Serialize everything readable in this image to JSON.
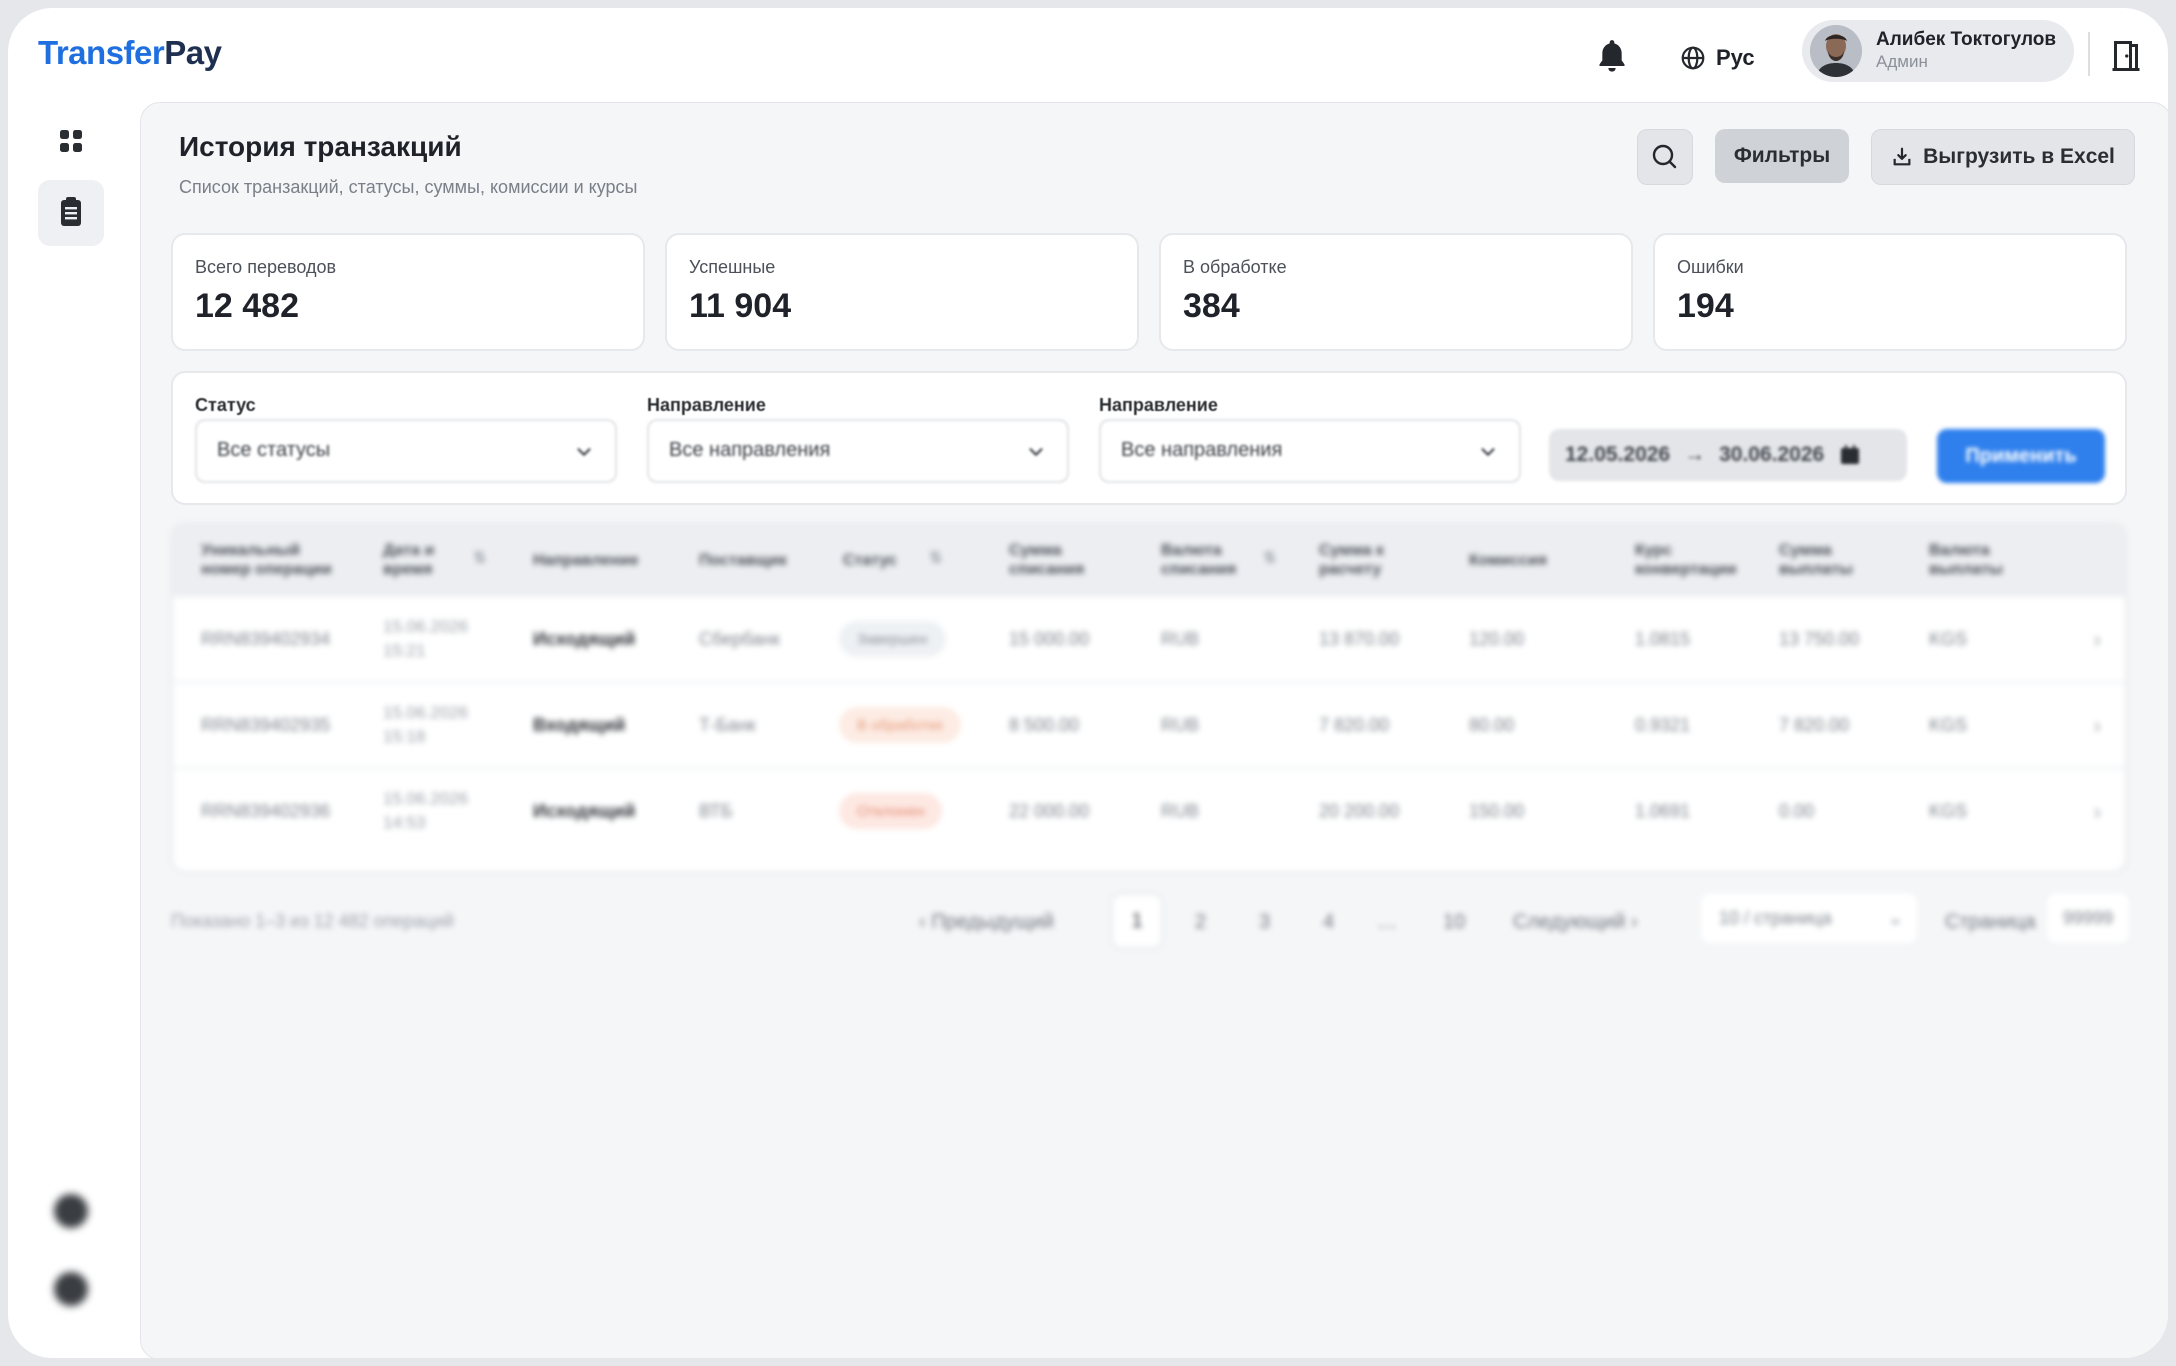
{
  "app": {
    "logo_part1": "Transfer",
    "logo_part2": "Pay"
  },
  "header": {
    "language": "Рус",
    "user_name": "Алибек Токтогулов",
    "user_role": "Админ",
    "icons": [
      "bell-icon",
      "globe-icon",
      "logout-door-icon"
    ]
  },
  "sidebar": {
    "items": [
      {
        "icon": "grid-icon"
      },
      {
        "icon": "clipboard-icon",
        "active": true
      }
    ]
  },
  "page": {
    "title": "История транзакций",
    "subtitle": "Список транзакций, статусы, суммы, комиссии и курсы",
    "filters_label": "Фильтры",
    "export_label": "Выгрузить в Excel"
  },
  "stats": [
    {
      "label": "Всего переводов",
      "value": "12 482"
    },
    {
      "label": "Успешные",
      "value": "11 904"
    },
    {
      "label": "В обработке",
      "value": "384"
    },
    {
      "label": "Ошибки",
      "value": "194"
    }
  ],
  "filters": {
    "status_label": "Статус",
    "status_value": "Все статусы",
    "direction_label": "Направление",
    "direction_value": "Все направления",
    "direction2_label": "Направление",
    "direction2_value": "Все направления",
    "date_from": "12.05.2026",
    "date_to": "30.06.2026",
    "apply_label": "Применить"
  },
  "table": {
    "columns": [
      "Уникальный номер операции",
      "Дата и время",
      "Направление",
      "Поставщик",
      "Статус",
      "Сумма списания",
      "Валюта списания",
      "Сумма к расчету",
      "Комиссия",
      "Курс конвертации",
      "Сумма выплаты",
      "Валюта выплаты"
    ],
    "rows": [
      {
        "id": "RRN839402934",
        "date": "15.06.2026",
        "time": "15:21",
        "direction": "Исходящий",
        "provider": "Сбербанк",
        "status": "Завершен",
        "amount": "15 000.00",
        "currency": "RUB",
        "settle": "13 870.00",
        "fee": "120.00",
        "rate": "1.0815",
        "payout": "13 750.00",
        "payout_currency": "KGS"
      },
      {
        "id": "RRN839402935",
        "date": "15.06.2026",
        "time": "15:18",
        "direction": "Входящий",
        "provider": "Т-Банк",
        "status": "В обработке",
        "amount": "8 500.00",
        "currency": "RUB",
        "settle": "7 820.00",
        "fee": "80.00",
        "rate": "0.9321",
        "payout": "7 820.00",
        "payout_currency": "KGS"
      },
      {
        "id": "RRN839402936",
        "date": "15.06.2026",
        "time": "14:53",
        "direction": "Исходящий",
        "provider": "ВТБ",
        "status": "Отклонен",
        "amount": "22 000.00",
        "currency": "RUB",
        "settle": "20 200.00",
        "fee": "150.00",
        "rate": "1.0691",
        "payout": "0.00",
        "payout_currency": "KGS"
      }
    ],
    "status_colors": {
      "Завершен": "#eef1f4",
      "В обработке": "#fdece4",
      "Отклонен": "#fde8e2"
    }
  },
  "pagination": {
    "info": "Показано 1–3 из 12 482 операций",
    "prev": "Предыдущий",
    "pages": [
      "1",
      "2",
      "3",
      "4",
      "…",
      "10"
    ],
    "next": "Следующий",
    "per_page": "10 / страница",
    "goto_label": "Страница",
    "goto_value": "99999"
  },
  "colors": {
    "brand": "#1f6fe0",
    "primary_button": "#2f80ed"
  }
}
